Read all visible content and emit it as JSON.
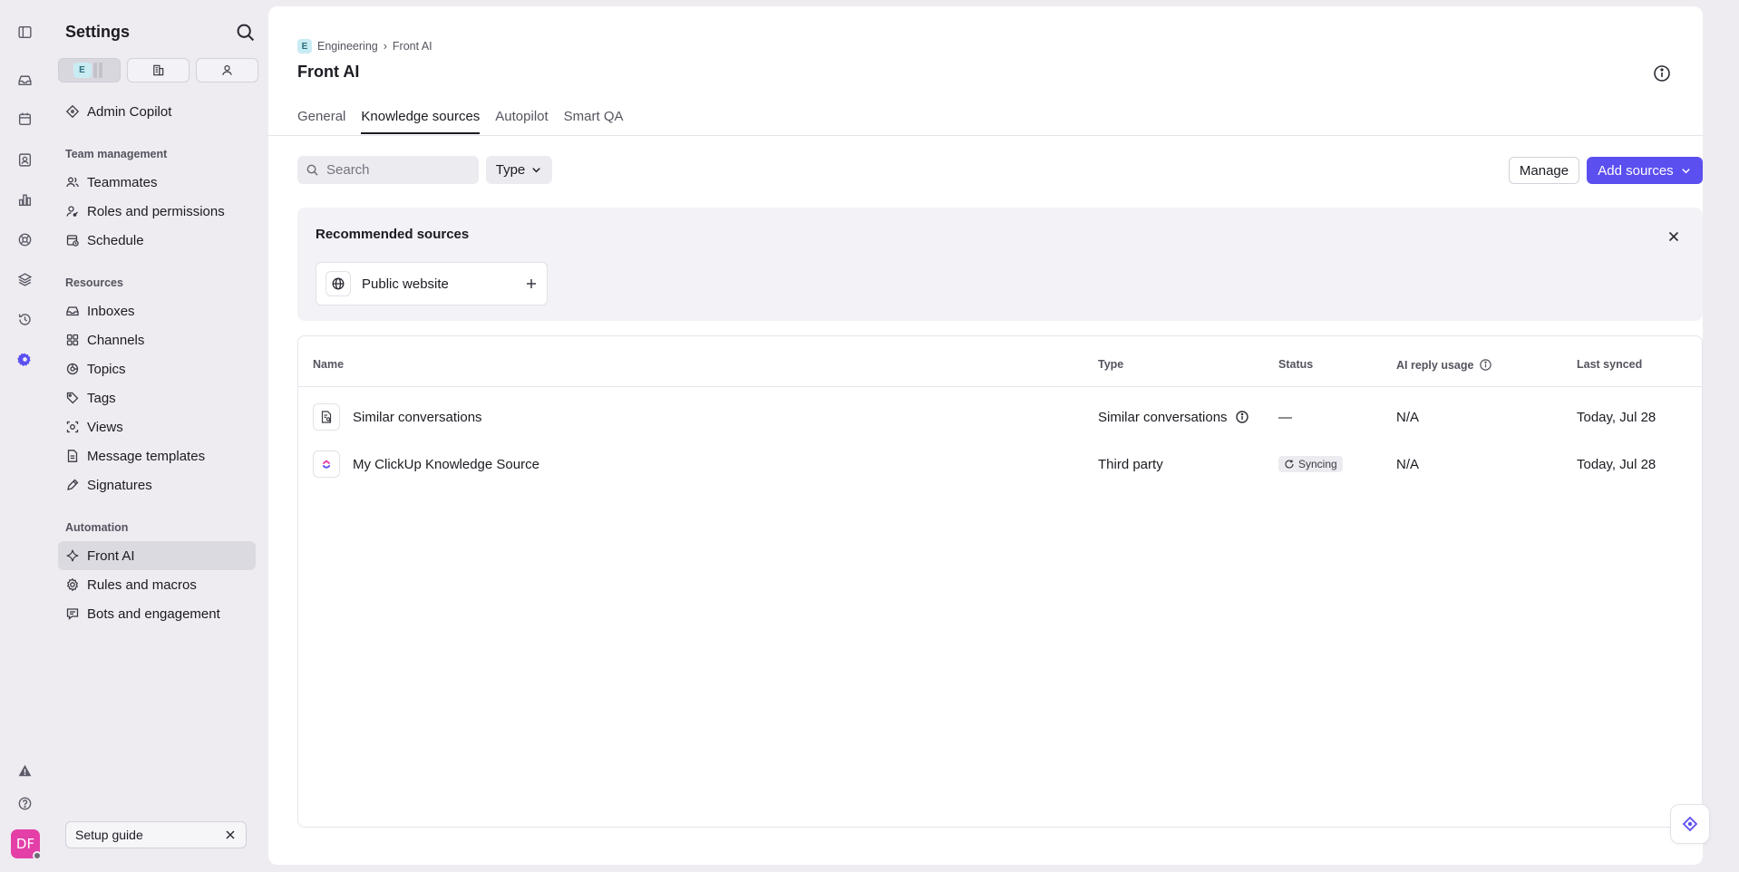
{
  "rail": {
    "icons": [
      "sidebar-toggle-icon",
      "inbox-icon",
      "calendar-icon",
      "contacts-icon",
      "analytics-icon",
      "help-center-icon",
      "layers-icon",
      "history-icon",
      "settings-icon",
      "alert-icon",
      "help-icon"
    ],
    "active": "settings-icon",
    "avatar_initials": "DF",
    "avatar_color": "#e33fa6"
  },
  "sidebar": {
    "title": "Settings",
    "scope_badge": "E",
    "top_item": "Admin Copilot",
    "sections": [
      {
        "label": "Team management",
        "items": [
          "Teammates",
          "Roles and permissions",
          "Schedule"
        ]
      },
      {
        "label": "Resources",
        "items": [
          "Inboxes",
          "Channels",
          "Topics",
          "Tags",
          "Views",
          "Message templates",
          "Signatures"
        ]
      },
      {
        "label": "Automation",
        "items": [
          "Front AI",
          "Rules and macros",
          "Bots and engagement"
        ]
      }
    ],
    "active_item": "Front AI",
    "setup_guide": "Setup guide"
  },
  "main": {
    "breadcrumb": {
      "badge": "E",
      "parent": "Engineering",
      "current": "Front AI"
    },
    "title": "Front AI",
    "tabs": [
      "General",
      "Knowledge sources",
      "Autopilot",
      "Smart QA"
    ],
    "active_tab": "Knowledge sources",
    "search_placeholder": "Search",
    "type_filter": "Type",
    "manage_label": "Manage",
    "add_sources_label": "Add sources",
    "accent_color": "#5b4ff0",
    "recommended": {
      "title": "Recommended sources",
      "cards": [
        {
          "label": "Public website"
        }
      ]
    },
    "table": {
      "headers": {
        "name": "Name",
        "type": "Type",
        "status": "Status",
        "usage": "AI reply usage",
        "synced": "Last synced"
      },
      "rows": [
        {
          "name": "Similar conversations",
          "type": "Similar conversations",
          "status": "—",
          "usage": "N/A",
          "synced": "Today, Jul 28"
        },
        {
          "name": "My ClickUp Knowledge Source",
          "type": "Third party",
          "status": "Syncing",
          "usage": "N/A",
          "synced": "Today, Jul 28"
        }
      ]
    }
  }
}
